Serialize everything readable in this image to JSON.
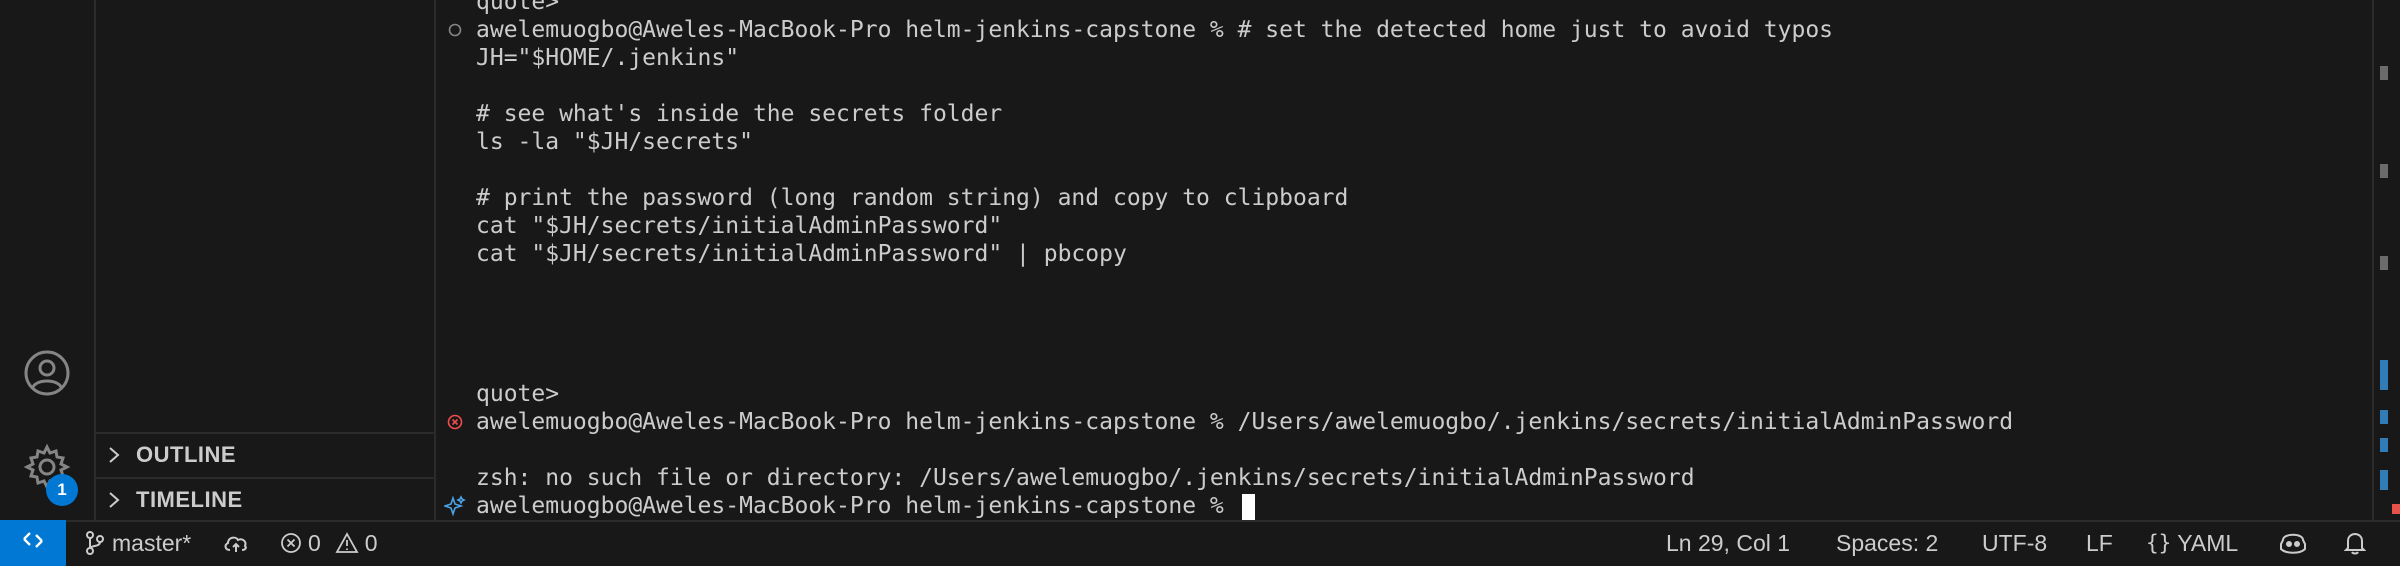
{
  "activity_bar": {
    "manage_badge": "1"
  },
  "sidebar": {
    "sections": [
      {
        "label": "OUTLINE"
      },
      {
        "label": "TIMELINE"
      }
    ]
  },
  "terminal": {
    "lines": [
      {
        "text": "quote>",
        "decoration": "none"
      },
      {
        "text": "awelemuogbo@Aweles-MacBook-Pro helm-jenkins-capstone % # set the detected home just to avoid typos",
        "decoration": "circle"
      },
      {
        "text": "JH=\"$HOME/.jenkins\"",
        "decoration": "none"
      },
      {
        "text": "",
        "decoration": "none"
      },
      {
        "text": "# see what's inside the secrets folder",
        "decoration": "none"
      },
      {
        "text": "ls -la \"$JH/secrets\"",
        "decoration": "none"
      },
      {
        "text": "",
        "decoration": "none"
      },
      {
        "text": "# print the password (long random string) and copy to clipboard",
        "decoration": "none"
      },
      {
        "text": "cat \"$JH/secrets/initialAdminPassword\"",
        "decoration": "none"
      },
      {
        "text": "cat \"$JH/secrets/initialAdminPassword\" | pbcopy",
        "decoration": "none"
      },
      {
        "text": "",
        "decoration": "none"
      },
      {
        "text": "",
        "decoration": "none"
      },
      {
        "text": "",
        "decoration": "none"
      },
      {
        "text": "",
        "decoration": "none"
      },
      {
        "text": "quote>",
        "decoration": "none"
      },
      {
        "text": "awelemuogbo@Aweles-MacBook-Pro helm-jenkins-capstone % /Users/awelemuogbo/.jenkins/secrets/initialAdminPassword",
        "decoration": "error"
      },
      {
        "text": "",
        "decoration": "none"
      },
      {
        "text": "zsh: no such file or directory: /Users/awelemuogbo/.jenkins/secrets/initialAdminPassword",
        "decoration": "none"
      },
      {
        "text": "awelemuogbo@Aweles-MacBook-Pro helm-jenkins-capstone % ",
        "decoration": "sparkle"
      }
    ]
  },
  "status_bar": {
    "branch": "master*",
    "errors": "0",
    "warnings": "0",
    "cursor_position": "Ln 29, Col 1",
    "indentation": "Spaces: 2",
    "encoding": "UTF-8",
    "eol": "LF",
    "language": "YAML"
  },
  "colors": {
    "accent": "#0078d4",
    "error": "#f14c4c",
    "background": "#181818"
  }
}
